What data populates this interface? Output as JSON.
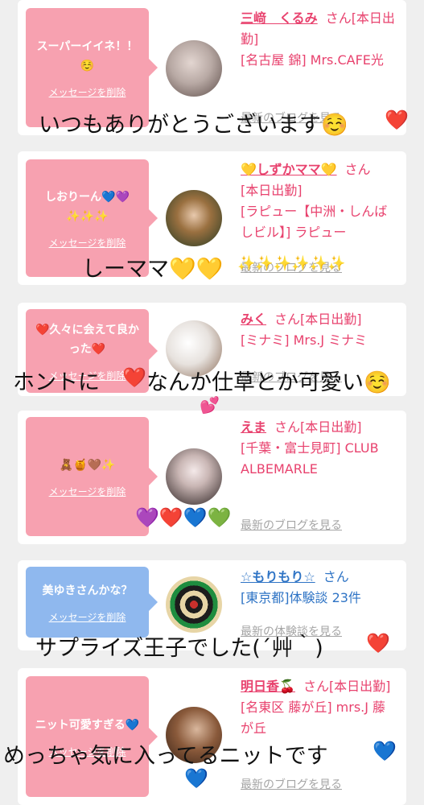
{
  "cards": [
    {
      "message": "スーパーイイネ！！☺️",
      "delete_label": "メッセージを削除",
      "name": "三﨑　くるみ",
      "san_suffix": "さん[本日出勤]",
      "shop": "[名古屋 錦] Mrs.CAFE光",
      "blog_link": "最新のブログを見る",
      "bubble_color": "#f7a1b0"
    },
    {
      "message": "しおりーん💙💜✨✨✨",
      "delete_label": "メッセージを削除",
      "name": "💛しずかママ💛",
      "san_suffix": "さん",
      "status": "[本日出勤]",
      "shop": "[ラピュー【中洲・しんばしビル】] ラピュー",
      "blog_link": "最新のブログを見る",
      "bubble_color": "#f7a1b0"
    },
    {
      "message": "❤️久々に会えて良かった❤️",
      "delete_label": "メッセージを削除",
      "name": "みく",
      "san_suffix": "さん[本日出勤]",
      "shop": "[ミナミ] Mrs.J ミナミ",
      "blog_link": "最新のブログを見る",
      "bubble_color": "#f7a1b0"
    },
    {
      "message": "🧸🍯🤎✨",
      "delete_label": "メッセージを削除",
      "name": "えま",
      "san_suffix": "さん[本日出勤]",
      "shop": "[千葉・富士見町] CLUB ALBEMARLE",
      "blog_link": "最新のブログを見る",
      "bubble_color": "#f7a1b0"
    },
    {
      "message": "美ゆきさんかな？",
      "delete_label": "メッセージを削除",
      "name": "☆もりもり☆",
      "san_suffix": "さん",
      "shop": "[東京都]体験談 23件",
      "blog_link": "最新の体験談を見る",
      "bubble_color": "#8fb8ee"
    },
    {
      "message": "ニット可愛すぎる💙",
      "delete_label": "メッセージを削除",
      "name": "明日香🍒",
      "san_suffix": "さん[本日出勤]",
      "shop": "[名東区 藤が丘] mrs.J 藤が丘",
      "blog_link": "最新のブログを見る",
      "bubble_color": "#f7a1b0"
    }
  ],
  "overlays": [
    "いつもありがとうございます☺️",
    "❤️",
    "しーママ💛💛",
    "✨✨✨✨✨✨",
    "ホントに",
    "❤️",
    "なんか仕草とか可愛い☺️",
    "💕",
    "💜❤️💙💚",
    "サプライズ王子でした(´艸｀)",
    "❤️",
    "めっちゃ気に入ってるニットです",
    "💙",
    "💙"
  ],
  "colors": {
    "accent_pink": "#e8426e",
    "accent_blue": "#2f74c5",
    "bubble_pink": "#f7a1b0",
    "bubble_blue": "#8fb8ee"
  }
}
